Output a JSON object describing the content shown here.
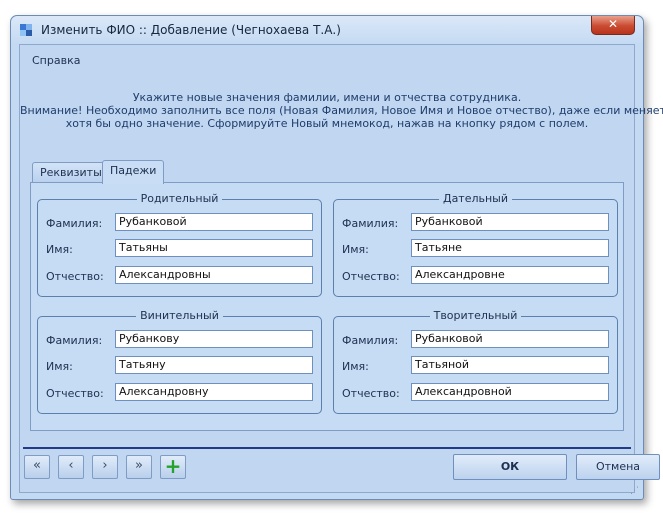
{
  "window": {
    "title": "Изменить ФИО :: Добавление  (Чегнохаева Т.А.)",
    "close_label": "✕"
  },
  "menu": {
    "help": "Справка"
  },
  "info": {
    "line1": "Укажите новые значения фамилии, имени и отчества сотрудника.",
    "line2": "Внимание! Необходимо заполнить все поля (Новая Фамилия, Новое Имя и Новое отчество), даже если меняется",
    "line3": "хотя бы одно значение. Сформируйте Новый мнемокод, нажав на кнопку рядом с полем."
  },
  "tabs": [
    {
      "label": "Реквизиты"
    },
    {
      "label": "Падежи"
    }
  ],
  "labels": {
    "surname": "Фамилия:",
    "name": "Имя:",
    "patronymic": "Отчество:"
  },
  "groups": {
    "genitive": {
      "title": "Родительный",
      "surname": "Рубанковой",
      "name": "Татьяны",
      "patronymic": "Александровны"
    },
    "dative": {
      "title": "Дательный",
      "surname": "Рубанковой",
      "name": "Татьяне",
      "patronymic": "Александровне"
    },
    "accusative": {
      "title": "Винительный",
      "surname": "Рубанкову",
      "name": "Татьяну",
      "patronymic": "Александровну"
    },
    "instrumental": {
      "title": "Творительный",
      "surname": "Рубанковой",
      "name": "Татьяной",
      "patronymic": "Александровной"
    }
  },
  "nav": {
    "first": "«",
    "prev": "‹",
    "next": "›",
    "last": "»",
    "add": "+"
  },
  "buttons": {
    "ok": "ОК",
    "cancel": "Отмена"
  }
}
